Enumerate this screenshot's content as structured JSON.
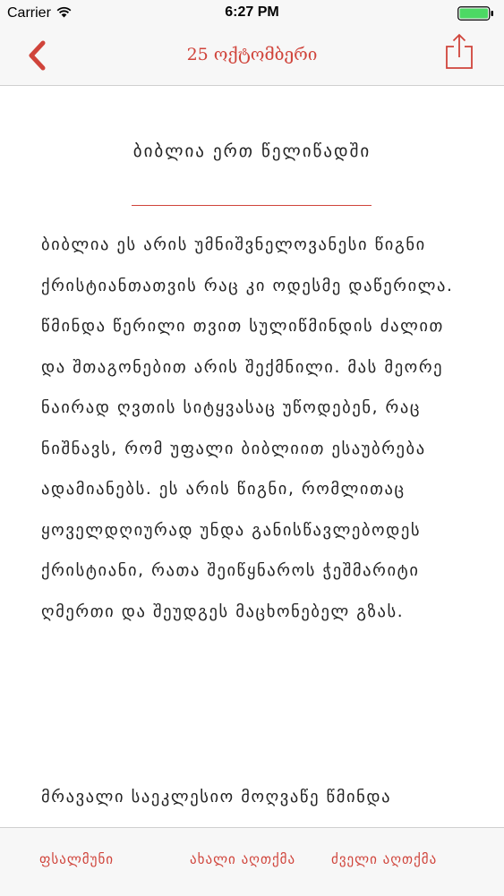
{
  "status_bar": {
    "carrier": "Carrier",
    "time": "6:27 PM",
    "wifi_icon": "wifi-icon",
    "battery_icon": "battery-full-icon",
    "battery_color": "#4cd964"
  },
  "nav_bar": {
    "title": "25 ოქტომბერი",
    "back_icon": "chevron-left-icon",
    "share_icon": "share-icon",
    "accent_color": "#d0443b"
  },
  "article": {
    "title": "ბიბლია ერთ წელიწადში",
    "paragraphs": [
      "ბიბლია ეს არის უმნიშვნელოვანესი წიგნი ქრისტიანთათვის რაც კი ოდესმე დაწერილა. წმინდა წერილი თვით სულიწმინდის ძალით და შთაგონებით არის შექმნილი. მას მეორე ნაირად ღვთის სიტყვასაც უწოდებენ, რაც ნიშნავს, რომ უფალი ბიბლიით  ესაუბრება ადამიანებს. ეს არის წიგნი, რომლითაც ყოველდღიურად უნდა განისწავლებოდეს ქრისტიანი, რათა შეიწყნაროს ჭეშმარიტი ღმერთი და შეუდგეს მაცხონებელ გზას.",
      "მრავალი საეკლესიო მოღვაწე წმინდა"
    ]
  },
  "tab_bar": {
    "tabs": [
      {
        "label": "ფსალმუნი"
      },
      {
        "label": "ახალი აღთქმა"
      },
      {
        "label": "ძველი აღთქმა"
      }
    ]
  }
}
